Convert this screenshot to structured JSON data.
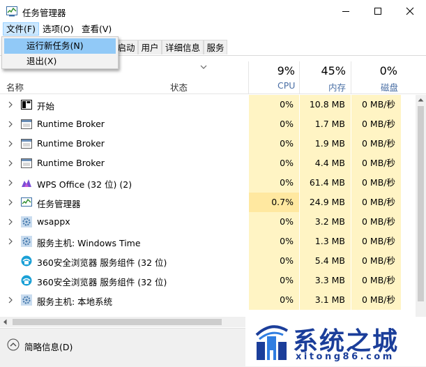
{
  "window": {
    "title": "任务管理器"
  },
  "menu": [
    {
      "label": "文件(F)",
      "active": true
    },
    {
      "label": "选项(O)",
      "active": false
    },
    {
      "label": "查看(V)",
      "active": false
    }
  ],
  "file_menu": [
    {
      "label": "运行新任务(N)"
    },
    {
      "label": "退出(X)"
    }
  ],
  "tabs": [
    {
      "label": "启动"
    },
    {
      "label": "用户"
    },
    {
      "label": "详细信息"
    },
    {
      "label": "服务"
    }
  ],
  "columns": {
    "name": "名称",
    "status": "状态",
    "cpu": {
      "pct": "9%",
      "label": "CPU"
    },
    "memory": {
      "pct": "45%",
      "label": "内存"
    },
    "disk": {
      "pct": "0%",
      "label": "磁盘"
    }
  },
  "processes": [
    {
      "name": "开始",
      "cpu": "0%",
      "mem": "10.8 MB",
      "disk": "0 MB/秒",
      "icon": "start-icon",
      "expandable": true
    },
    {
      "name": "Runtime Broker",
      "cpu": "0%",
      "mem": "1.7 MB",
      "disk": "0 MB/秒",
      "icon": "window-app-icon",
      "expandable": true
    },
    {
      "name": "Runtime Broker",
      "cpu": "0%",
      "mem": "1.9 MB",
      "disk": "0 MB/秒",
      "icon": "window-app-icon",
      "expandable": true
    },
    {
      "name": "Runtime Broker",
      "cpu": "0%",
      "mem": "4.4 MB",
      "disk": "0 MB/秒",
      "icon": "window-app-icon",
      "expandable": true
    },
    {
      "name": "WPS Office (32 位) (2)",
      "cpu": "0%",
      "mem": "61.4 MB",
      "disk": "0 MB/秒",
      "icon": "wps-icon",
      "expandable": true
    },
    {
      "name": "任务管理器",
      "cpu": "0.7%",
      "mem": "24.9 MB",
      "disk": "0 MB/秒",
      "icon": "task-manager-icon",
      "expandable": true
    },
    {
      "name": "wsappx",
      "cpu": "0%",
      "mem": "3.2 MB",
      "disk": "0 MB/秒",
      "icon": "gear-icon",
      "expandable": true
    },
    {
      "name": "服务主机: Windows Time",
      "cpu": "0%",
      "mem": "1.3 MB",
      "disk": "0 MB/秒",
      "icon": "gear-icon",
      "expandable": true
    },
    {
      "name": "360安全浏览器 服务组件 (32 位)",
      "cpu": "0%",
      "mem": "5.4 MB",
      "disk": "0 MB/秒",
      "icon": "browser-360-icon",
      "expandable": false
    },
    {
      "name": "360安全浏览器 服务组件 (32 位)",
      "cpu": "0%",
      "mem": "3.3 MB",
      "disk": "0 MB/秒",
      "icon": "browser-360-icon",
      "expandable": false
    },
    {
      "name": "服务主机: 本地系统",
      "cpu": "0%",
      "mem": "3.1 MB",
      "disk": "0 MB/秒",
      "icon": "gear-icon",
      "expandable": true
    }
  ],
  "footer": {
    "fewer_details": "简略信息(D)"
  },
  "watermark": {
    "text": "系统之城",
    "url": "xitong86.com"
  },
  "colors": {
    "accent": "#cce8ff",
    "heat": "#fff4c4",
    "heat_strong": "#ffe8a0",
    "brand": "#1b3e9a"
  }
}
